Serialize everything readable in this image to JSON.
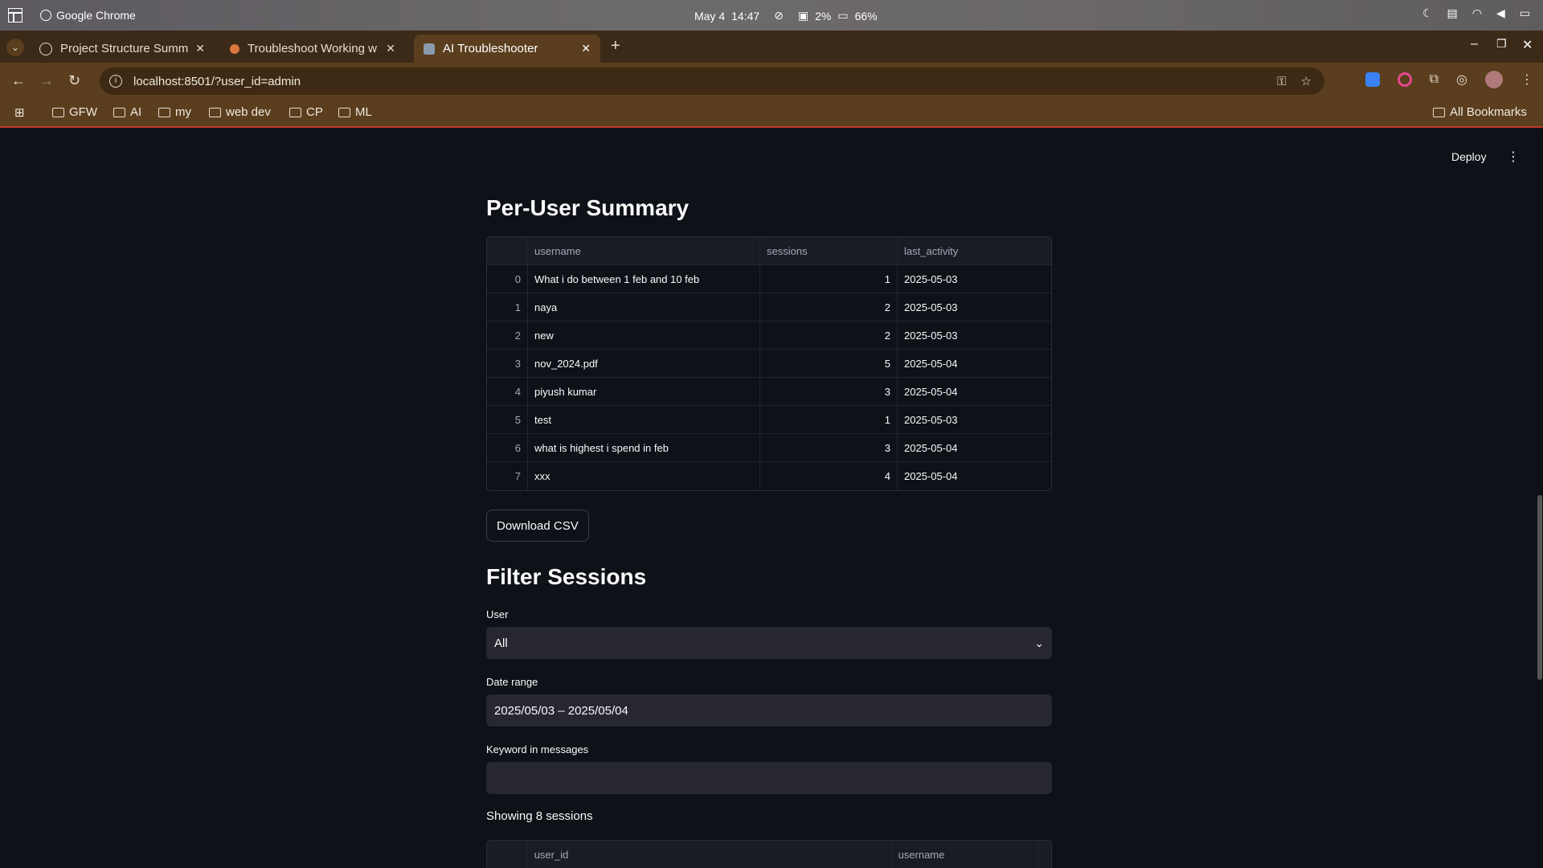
{
  "os": {
    "app_name": "Google Chrome",
    "date": "May 4",
    "time": "14:47",
    "cpu": "2%",
    "battery": "66%"
  },
  "browser": {
    "tabs": [
      {
        "title": "Project Structure Summ",
        "active": false
      },
      {
        "title": "Troubleshoot Working w",
        "active": false
      },
      {
        "title": "AI Troubleshooter",
        "active": true
      }
    ],
    "url": "localhost:8501/?user_id=admin",
    "bookmarks": [
      "GFW",
      "AI",
      "my",
      "web dev",
      "CP",
      "ML"
    ],
    "all_bookmarks": "All Bookmarks"
  },
  "app": {
    "deploy_label": "Deploy",
    "summary_title": "Per-User Summary",
    "summary_columns": [
      "username",
      "sessions",
      "last_activity"
    ],
    "summary_rows": [
      {
        "idx": "0",
        "username": "What i do between 1 feb and 10 feb",
        "sessions": "1",
        "last_activity": "2025-05-03"
      },
      {
        "idx": "1",
        "username": "naya",
        "sessions": "2",
        "last_activity": "2025-05-03"
      },
      {
        "idx": "2",
        "username": "new",
        "sessions": "2",
        "last_activity": "2025-05-03"
      },
      {
        "idx": "3",
        "username": "nov_2024.pdf",
        "sessions": "5",
        "last_activity": "2025-05-04"
      },
      {
        "idx": "4",
        "username": "piyush kumar",
        "sessions": "3",
        "last_activity": "2025-05-04"
      },
      {
        "idx": "5",
        "username": "test",
        "sessions": "1",
        "last_activity": "2025-05-03"
      },
      {
        "idx": "6",
        "username": "what is highest i spend in feb",
        "sessions": "3",
        "last_activity": "2025-05-04"
      },
      {
        "idx": "7",
        "username": "xxx",
        "sessions": "4",
        "last_activity": "2025-05-04"
      }
    ],
    "download_label": "Download CSV",
    "filter_title": "Filter Sessions",
    "user_label": "User",
    "user_value": "All",
    "date_label": "Date range",
    "date_value": "2025/05/03 – 2025/05/04",
    "keyword_label": "Keyword in messages",
    "keyword_value": "",
    "showing_text": "Showing 8 sessions",
    "sessions_columns": [
      "user_id",
      "username"
    ]
  }
}
